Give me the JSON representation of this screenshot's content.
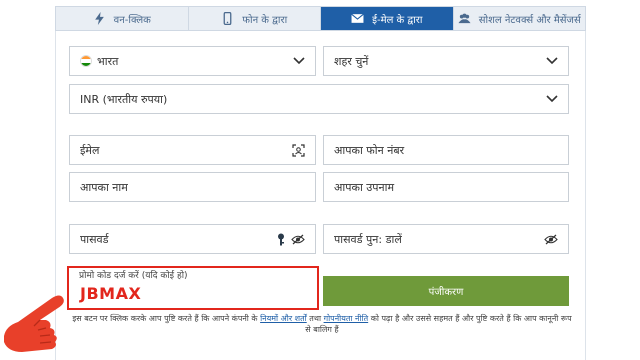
{
  "tabs": [
    {
      "label": "वन-क्लिक",
      "icon": "lightning-icon",
      "active": false
    },
    {
      "label": "फोन के द्वारा",
      "icon": "phone-icon",
      "active": false
    },
    {
      "label": "ई-मेल के द्वारा",
      "icon": "envelope-icon",
      "active": true
    },
    {
      "label": "सोशल नेटवर्क्स और मैसेंजर्स",
      "icon": "users-icon",
      "active": false
    }
  ],
  "form": {
    "country": {
      "value": "भारत",
      "icon": "india-flag-icon"
    },
    "city": {
      "placeholder": "शहर चुनें"
    },
    "currency": {
      "value": "INR (भारतीय रुपया)"
    },
    "email": {
      "placeholder": "ईमेल"
    },
    "phone": {
      "placeholder": "आपका फोन नंबर"
    },
    "first_name": {
      "placeholder": "आपका नाम"
    },
    "last_name": {
      "placeholder": "आपका उपनाम"
    },
    "password": {
      "placeholder": "पासवर्ड"
    },
    "password_confirm": {
      "placeholder": "पासवर्ड पुन: डालें"
    },
    "promo": {
      "label": "प्रोमो कोड दर्ज करें (यदि कोई हो)",
      "value": "JBMAX"
    },
    "register_label": "पंजीकरण"
  },
  "terms": {
    "prefix": "इस बटन पर क्लिक करके आप पुष्टि करते हैं कि आपने कंपनी के",
    "rules_link": "नियमों और शर्तों",
    "middle": "तथा",
    "privacy_link": "गोपनीयता नीति",
    "suffix": "को पढ़ा है और उससे सहमत हैं और पुष्टि करते हैं कि आप कानूनी रूप से बालिग हैं"
  },
  "colors": {
    "active_tab": "#1f5fa7",
    "register_button": "#6f9a3a",
    "promo_highlight": "#e2261c",
    "hand": "#e8402a"
  }
}
